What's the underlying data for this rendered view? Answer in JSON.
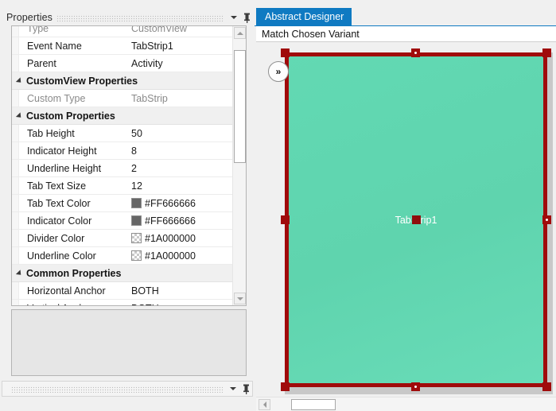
{
  "properties_panel": {
    "title": "Properties",
    "dropdown_icon": "caret-down-icon",
    "pin_icon": "pushpin-icon",
    "rows": [
      {
        "kind": "row",
        "name": "Type",
        "value": "CustomView",
        "readonly": true,
        "clipped": true
      },
      {
        "kind": "row",
        "name": "Event Name",
        "value": "TabStrip1",
        "readonly": false
      },
      {
        "kind": "row",
        "name": "Parent",
        "value": "Activity",
        "readonly": false,
        "dropdown": true
      },
      {
        "kind": "group",
        "name": "CustomView Properties"
      },
      {
        "kind": "row",
        "name": "Custom Type",
        "value": "TabStrip",
        "readonly": true
      },
      {
        "kind": "group",
        "name": "Custom Properties"
      },
      {
        "kind": "row",
        "name": "Tab Height",
        "value": "50",
        "readonly": false
      },
      {
        "kind": "row",
        "name": "Indicator Height",
        "value": "8",
        "readonly": false
      },
      {
        "kind": "row",
        "name": "Underline Height",
        "value": "2",
        "readonly": false
      },
      {
        "kind": "row",
        "name": "Tab Text Size",
        "value": "12",
        "readonly": false
      },
      {
        "kind": "row",
        "name": "Tab Text Color",
        "value": "#FF666666",
        "readonly": false,
        "swatch": "solid"
      },
      {
        "kind": "row",
        "name": "Indicator Color",
        "value": "#FF666666",
        "readonly": false,
        "swatch": "solid"
      },
      {
        "kind": "row",
        "name": "Divider Color",
        "value": "#1A000000",
        "readonly": false,
        "swatch": "alpha"
      },
      {
        "kind": "row",
        "name": "Underline Color",
        "value": "#1A000000",
        "readonly": false,
        "swatch": "alpha"
      },
      {
        "kind": "group",
        "name": "Common Properties"
      },
      {
        "kind": "row",
        "name": "Horizontal Anchor",
        "value": "BOTH",
        "readonly": false,
        "dropdown": true
      },
      {
        "kind": "row",
        "name": "Vertical Anchor",
        "value": "BOTH",
        "readonly": false,
        "dropdown": true
      }
    ],
    "swatch_colors": {
      "solid": "#666666",
      "alpha_checker": "#C9C9C9"
    },
    "description_text": ""
  },
  "bottom_panel": {
    "title": "",
    "dropdown_icon": "caret-down-icon",
    "pin_icon": "pushpin-icon"
  },
  "designer": {
    "tab_label": "Abstract Designer",
    "tab_color": "#0F7AC2",
    "variant_bar_label": "Match Chosen Variant",
    "expand_button_label": "»",
    "view_label": "TabStrip1",
    "surface_color": "#5FD4AE",
    "selection_color": "#A00B0B",
    "backing_color": "#C8C8C8"
  },
  "scrollbars": {
    "vertical_up_icon": "triangle-up-icon",
    "vertical_down_icon": "triangle-down-icon",
    "horizontal_left_icon": "triangle-left-icon"
  }
}
